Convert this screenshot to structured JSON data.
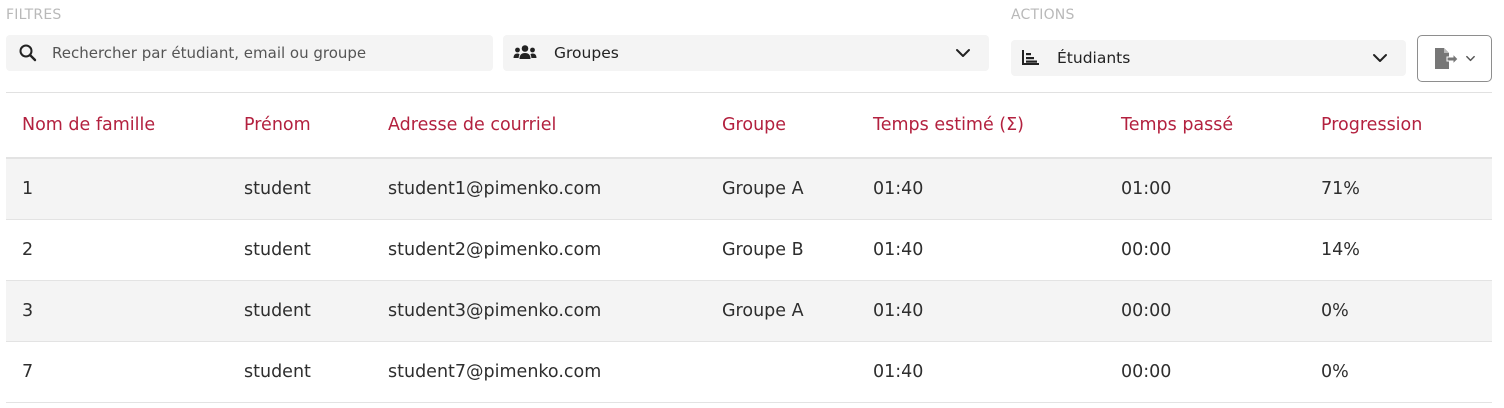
{
  "filters": {
    "label": "FILTRES",
    "search_placeholder": "Rechercher par étudiant, email ou groupe",
    "search_value": "",
    "group_select": "Groupes"
  },
  "actions": {
    "label": "ACTIONS",
    "view_select": "Étudiants"
  },
  "icons": {
    "search": "search-icon",
    "groups": "users-icon",
    "view": "chart-bar-icon",
    "export": "export-file-icon",
    "chevron": "chevron-down-icon"
  },
  "colors": {
    "header_text": "#b3213f",
    "row_alt": "#f4f4f4"
  },
  "table": {
    "headers": [
      "Nom de famille",
      "Prénom",
      "Adresse de courriel",
      "Groupe",
      "Temps estimé (Σ)",
      "Temps passé",
      "Progression"
    ],
    "rows": [
      [
        "1",
        "student",
        "student1@pimenko.com",
        "Groupe A",
        "01:40",
        "01:00",
        "71%"
      ],
      [
        "2",
        "student",
        "student2@pimenko.com",
        "Groupe B",
        "01:40",
        "00:00",
        "14%"
      ],
      [
        "3",
        "student",
        "student3@pimenko.com",
        "Groupe A",
        "01:40",
        "00:00",
        "0%"
      ],
      [
        "7",
        "student",
        "student7@pimenko.com",
        "",
        "01:40",
        "00:00",
        "0%"
      ]
    ]
  }
}
